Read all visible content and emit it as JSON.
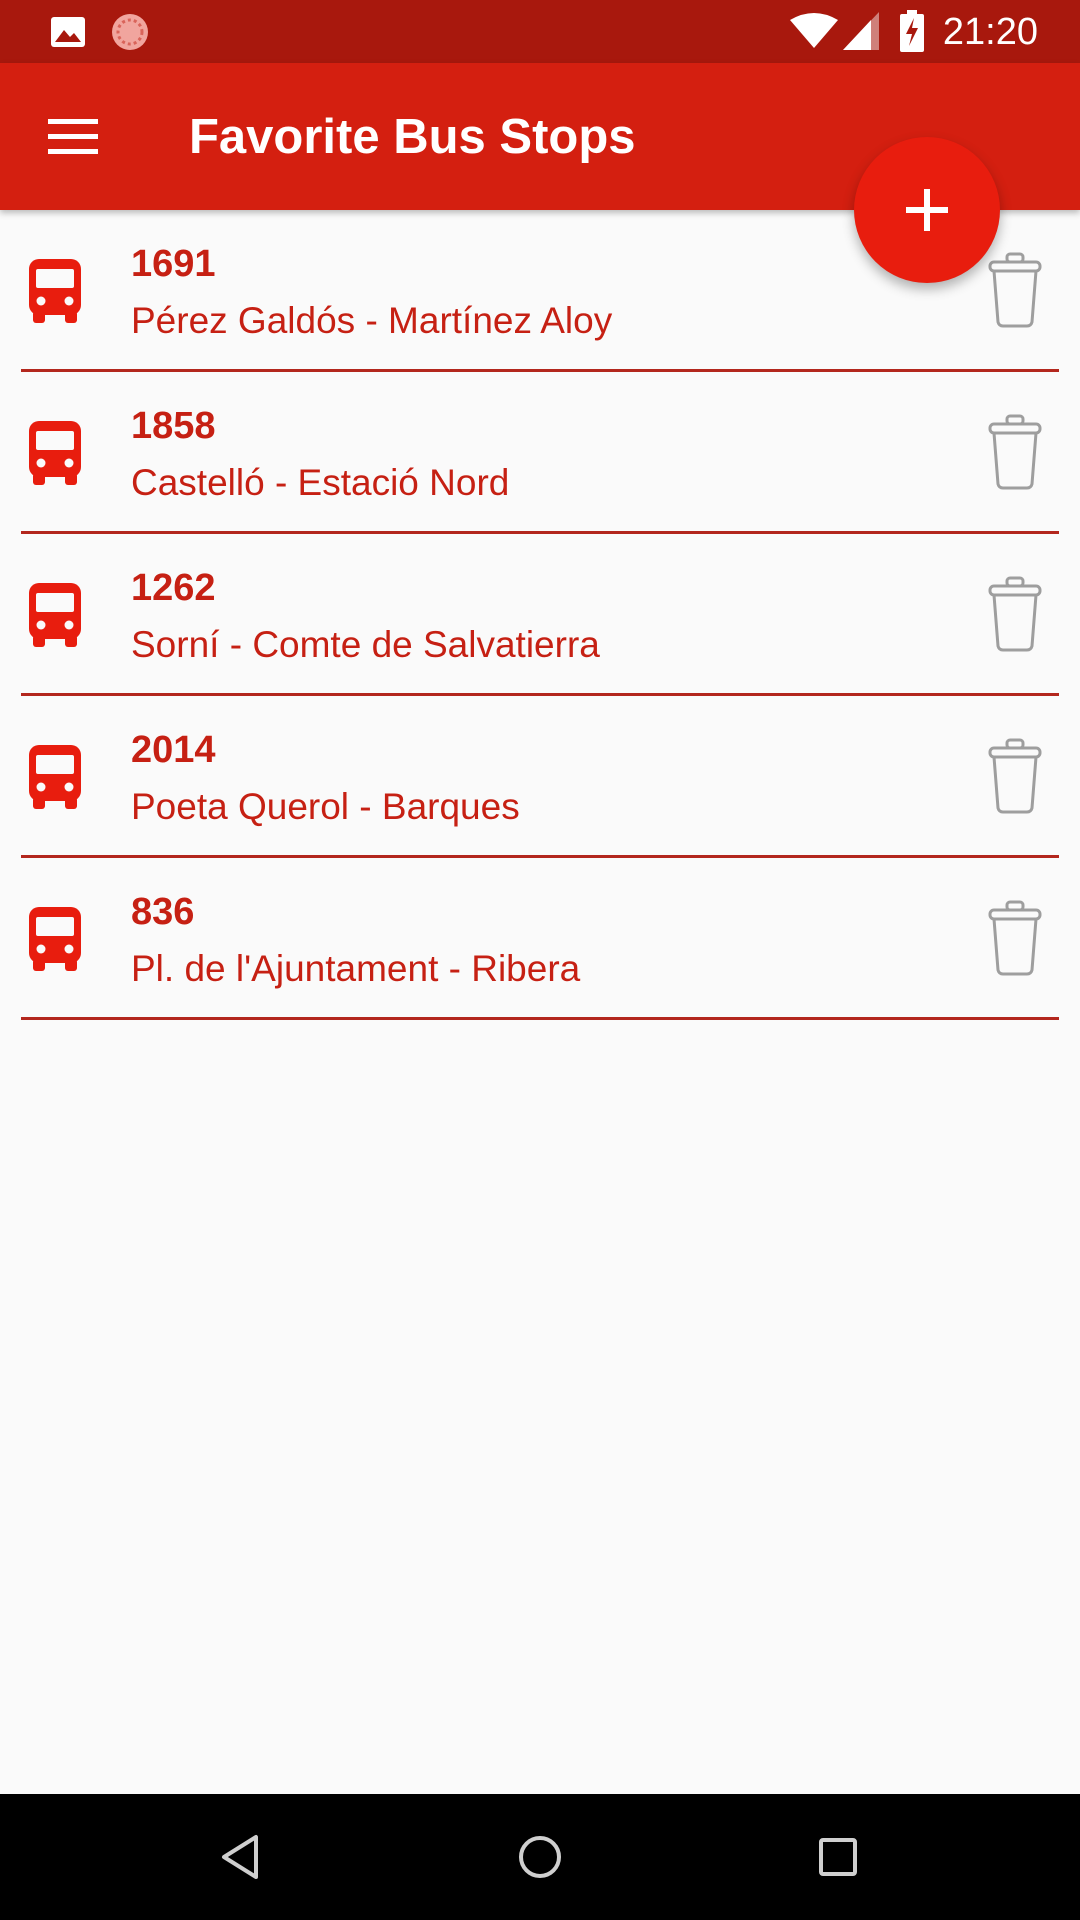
{
  "status_bar": {
    "time": "21:20",
    "icons": [
      "image-icon",
      "sync-circle-icon",
      "wifi-icon",
      "signal-icon",
      "battery-charging-icon"
    ]
  },
  "app_bar": {
    "title": "Favorite Bus Stops",
    "menu_icon": "hamburger-menu-icon"
  },
  "fab": {
    "icon": "plus-icon"
  },
  "stops": [
    {
      "code": "1691",
      "name": "Pérez Galdós - Martínez Aloy"
    },
    {
      "code": "1858",
      "name": "Castelló - Estació Nord"
    },
    {
      "code": "1262",
      "name": "Sorní - Comte de Salvatierra"
    },
    {
      "code": "2014",
      "name": "Poeta Querol - Barques"
    },
    {
      "code": "836",
      "name": "Pl. de l'Ajuntament - Ribera"
    }
  ],
  "colors": {
    "status_bar": "#a8180d",
    "app_bar": "#d41f10",
    "accent": "#e81d0e",
    "text_primary": "#c62013",
    "divider": "#b3271d",
    "trash_icon": "#9e9e9e"
  },
  "nav_bar": {
    "icons": [
      "back-triangle-icon",
      "home-circle-icon",
      "recents-square-icon"
    ]
  }
}
